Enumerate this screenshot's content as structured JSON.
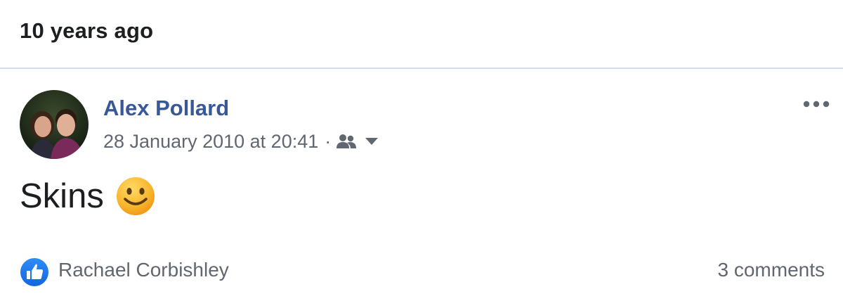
{
  "memory": {
    "title": "10 years ago"
  },
  "post": {
    "author": "Alex Pollard",
    "timestamp": "28 January 2010 at 20:41",
    "separator": "·",
    "audience_icon": "friends-icon",
    "text": "Skins",
    "emoji_icon": "smiley-face-icon",
    "likers": "Rachael Corbishley",
    "comments": "3 comments"
  },
  "colors": {
    "author_link": "#385898",
    "secondary_text": "#606770",
    "like_blue": "#1877f2",
    "divider": "#dadde1"
  }
}
